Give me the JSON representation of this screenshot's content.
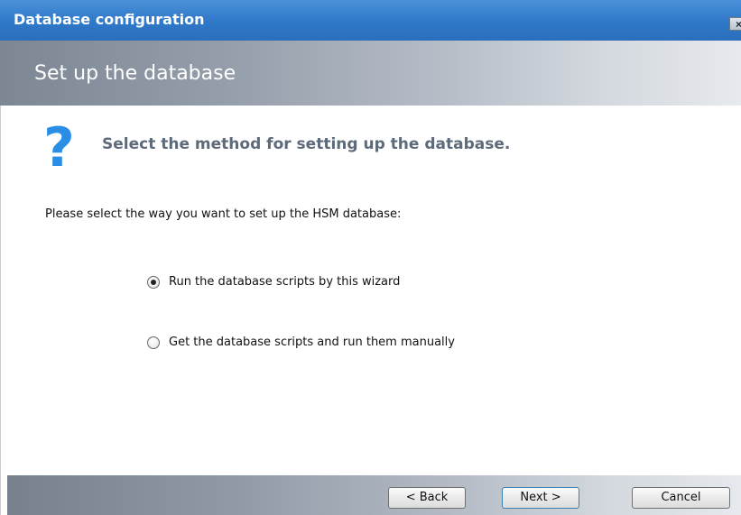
{
  "window": {
    "title": "Database configuration",
    "close_glyph": "×"
  },
  "header": {
    "title": "Set up the database"
  },
  "step": {
    "icon": "question-icon",
    "icon_glyph": "?",
    "heading": "Select the method for setting up the database."
  },
  "instruction": "Please select the way you want to set up the HSM database:",
  "options": [
    {
      "label": "Run the database scripts by this wizard",
      "selected": true
    },
    {
      "label": "Get the database scripts and run them manually",
      "selected": false
    }
  ],
  "buttons": {
    "back": "< Back",
    "next": "Next >",
    "cancel": "Cancel"
  },
  "colors": {
    "titlebar": "#2f78c8",
    "icon_accent": "#2a8ee6",
    "heading_text": "#5d6a7a"
  }
}
